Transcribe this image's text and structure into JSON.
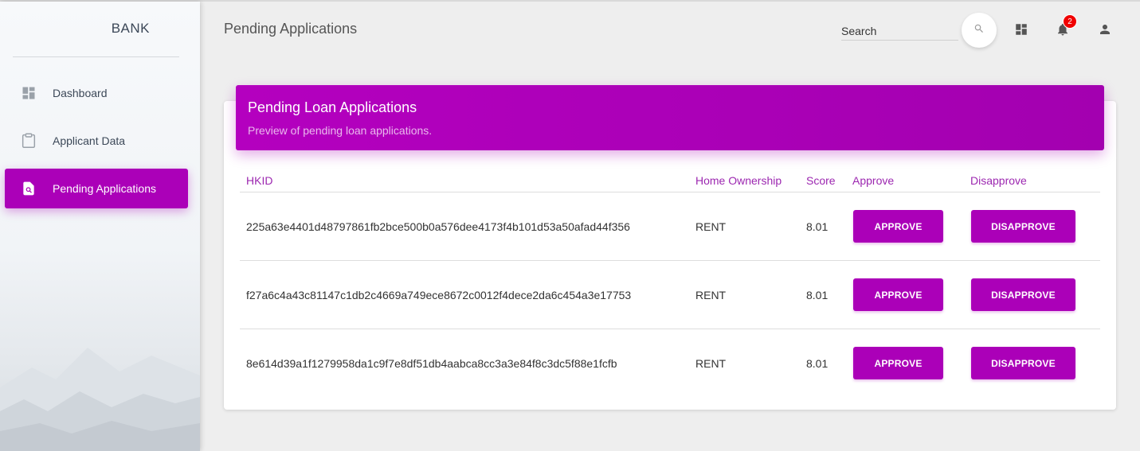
{
  "sidebar": {
    "brand": "BANK",
    "items": [
      {
        "label": "Dashboard",
        "icon": "dashboard-icon",
        "active": false
      },
      {
        "label": "Applicant Data",
        "icon": "clipboard-icon",
        "active": false
      },
      {
        "label": "Pending Applications",
        "icon": "search-document-icon",
        "active": true
      }
    ]
  },
  "header": {
    "title": "Pending Applications",
    "search_placeholder": "Search",
    "notification_count": "2"
  },
  "card": {
    "title": "Pending Loan Applications",
    "subtitle": "Preview of pending loan applications.",
    "columns": [
      "HKID",
      "Home Ownership",
      "Score",
      "Approve",
      "Disapprove"
    ],
    "rows": [
      {
        "hkid": "225a63e4401d48797861fb2bce500b0a576dee4173f4b101d53a50afad44f356",
        "ownership": "RENT",
        "score": "8.01"
      },
      {
        "hkid": "f27a6c4a43c81147c1db2c4669a749ece8672c0012f4dece2da6c454a3e17753",
        "ownership": "RENT",
        "score": "8.01"
      },
      {
        "hkid": "8e614d39a1f1279958da1c9f7e8df51db4aabca8cc3a3e84f8c3dc5f88e1fcfb",
        "ownership": "RENT",
        "score": "8.01"
      }
    ],
    "approve_label": "APPROVE",
    "disapprove_label": "DISAPPROVE"
  },
  "colors": {
    "accent": "#ab00b8",
    "header_text": "#9c27b0",
    "badge": "#f00000"
  }
}
